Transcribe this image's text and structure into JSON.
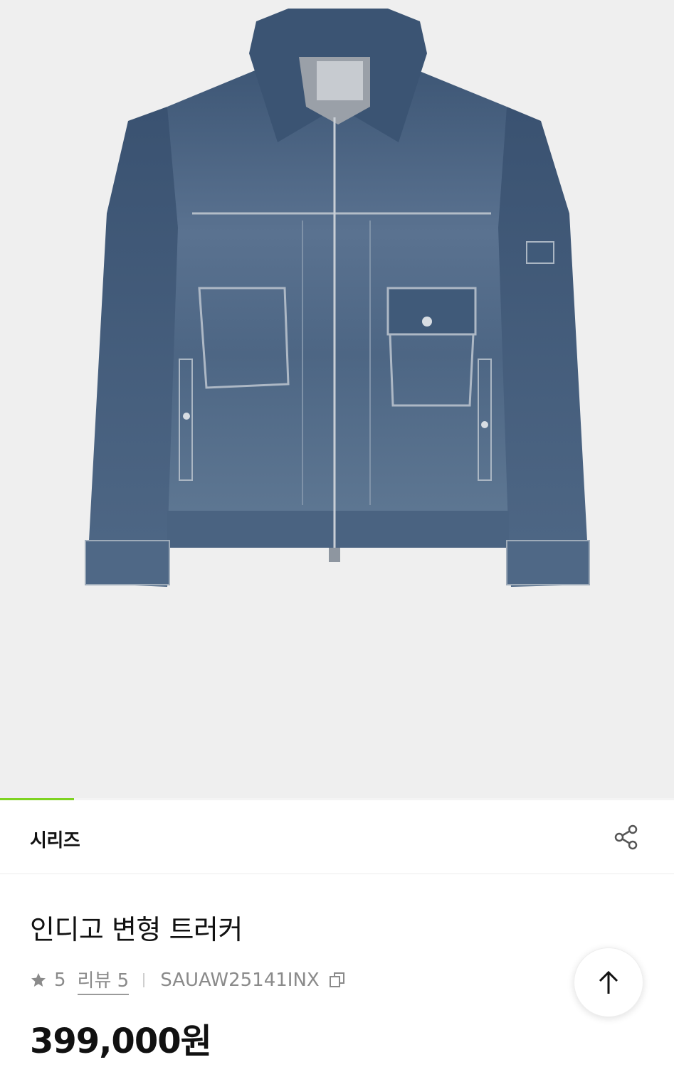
{
  "image": {
    "alt": "indigo denim trucker jacket",
    "progress": 0.11,
    "progress_color": "#7ed321"
  },
  "brand": {
    "name": "시리즈",
    "share_icon": "share-icon"
  },
  "product": {
    "title": "인디고 변형 트러커",
    "rating": "5",
    "review_label": "리뷰 5",
    "code": "SAUAW25141INX",
    "price": "399,000원"
  },
  "icons": {
    "star": "star-icon",
    "copy": "copy-icon",
    "scroll_top": "arrow-up-icon"
  },
  "colors": {
    "accent": "#7ed321",
    "text_primary": "#111111",
    "text_secondary": "#8a8a8a"
  }
}
